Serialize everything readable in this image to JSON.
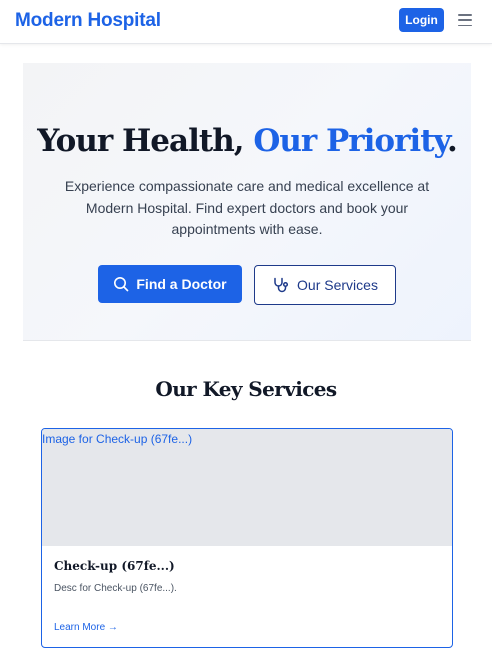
{
  "header": {
    "brand": "Modern Hospital",
    "login_label": "Login",
    "menu_icon": "hamburger-menu-icon"
  },
  "hero": {
    "title_main": "Your Health, ",
    "title_accent": "Our Priority",
    "title_end": ".",
    "description": "Experience compassionate care and medical excellence at Modern Hospital. Find expert doctors and book your appointments with ease.",
    "primary_button": {
      "label": "Find a Doctor",
      "icon": "search-icon"
    },
    "secondary_button": {
      "label": "Our Services",
      "icon": "stethoscope-icon"
    }
  },
  "services": {
    "title": "Our Key Services",
    "cards": [
      {
        "image_alt": "Image for Check-up (67fe...)",
        "title": "Check-up (67fe...)",
        "description": "Desc for Check-up (67fe...).",
        "link": "Learn More →"
      }
    ]
  },
  "colors": {
    "primary": "#1d63e6",
    "dark_navy": "#1e3a8a",
    "heading": "#111827",
    "image_placeholder": "#e5e7eb"
  }
}
